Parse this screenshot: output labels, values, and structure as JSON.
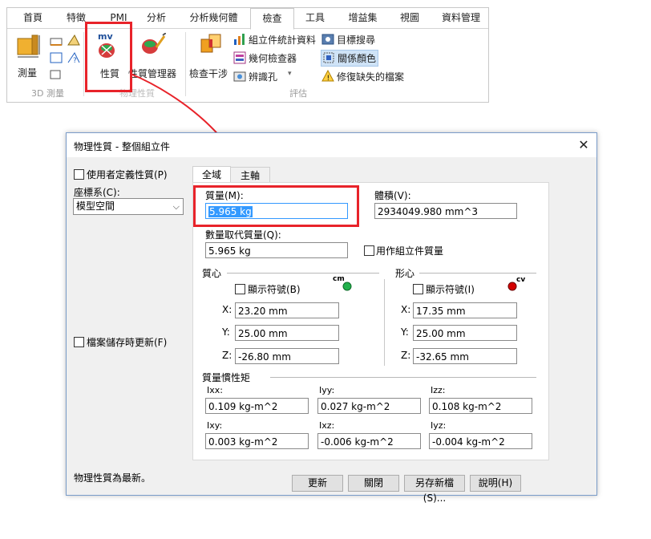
{
  "ribbon": {
    "tabs": [
      "首頁",
      "特徵",
      "PMI",
      "分析",
      "分析幾何體",
      "檢查",
      "工具",
      "增益集",
      "視圖",
      "資料管理"
    ],
    "active_tab": "檢查",
    "measure_label": "測量",
    "group_3d_measure": "3D 測量",
    "mass_props_label": "性質",
    "mass_props_icon_text": "mv",
    "mass_props_manager_label": "性質管理器",
    "group_mass_props": "物理性質",
    "interference_label": "檢查干涉",
    "assembly_stats_label": "組立件統計資料",
    "geometry_inspector_label": "幾何檢查器",
    "identify_holes_label": "辨識孔",
    "target_search_label": "目標搜尋",
    "relationship_colors_label": "關係顏色",
    "repair_missing_label": "修復缺失的檔案",
    "group_evaluate": "評估"
  },
  "dialog": {
    "title": "物理性質 - 整個組立件",
    "close_glyph": "✕",
    "use_custom_label": "使用者定義性質(P)",
    "coord_label": "座標系(C):",
    "coord_value": "模型空間",
    "update_on_save_label": "檔案儲存時更新(F)",
    "tabs": [
      "全域",
      "主軸"
    ],
    "mass_label": "質量(M):",
    "mass_value": "5.965 kg",
    "volume_label": "體積(V):",
    "volume_value": "2934049.980 mm^3",
    "qty_mass_label": "數量取代質量(Q):",
    "qty_mass_value": "5.965 kg",
    "use_as_assembly_mass_label": "用作組立件質量",
    "com_group": "質心",
    "com_show_symbol": "顯示符號(B)",
    "com_badge": "cm",
    "com_x": "23.20 mm",
    "com_y": "25.00 mm",
    "com_z": "-26.80 mm",
    "cov_group": "形心",
    "cov_show_symbol": "顯示符號(I)",
    "cov_badge": "cv",
    "cov_x": "17.35 mm",
    "cov_y": "25.00 mm",
    "cov_z": "-32.65 mm",
    "axis_x": "X:",
    "axis_y": "Y:",
    "axis_z": "Z:",
    "inertia_group": "質量慣性矩",
    "ixx_label": "Ixx:",
    "ixx": "0.109 kg-m^2",
    "iyy_label": "Iyy:",
    "iyy": "0.027 kg-m^2",
    "izz_label": "Izz:",
    "izz": "0.108 kg-m^2",
    "ixy_label": "Ixy:",
    "ixy": "0.003 kg-m^2",
    "ixz_label": "Ixz:",
    "ixz": "-0.006 kg-m^2",
    "iyz_label": "Iyz:",
    "iyz": "-0.004 kg-m^2",
    "status": "物理性質為最新。",
    "btn_update": "更新",
    "btn_close": "關閉",
    "btn_save_as": "另存新檔(S)...",
    "btn_help": "說明(H)"
  },
  "colors": {
    "annotation_red": "#e8232a",
    "com_green": "#22b14c",
    "cov_red": "#d40000",
    "selection_blue": "#3399ff"
  }
}
